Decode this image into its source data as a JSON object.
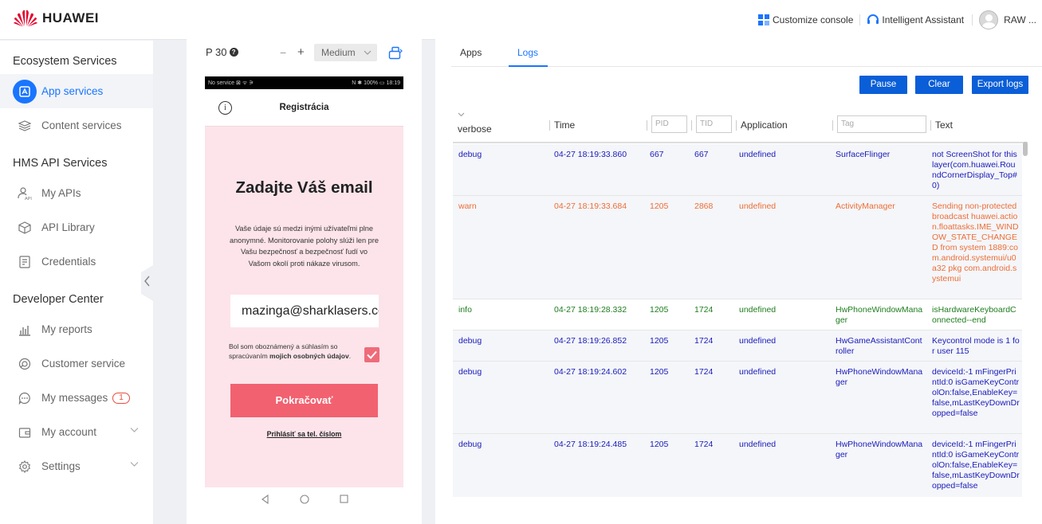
{
  "header": {
    "brand": "HUAWEI",
    "customize_console": "Customize console",
    "intelligent_assistant": "Intelligent Assistant",
    "user": "RAW ..."
  },
  "sidebar": {
    "sections": [
      {
        "title": "Ecosystem Services",
        "items": [
          {
            "label": "App services",
            "icon": "app-services-icon",
            "active": true
          },
          {
            "label": "Content services",
            "icon": "layers-icon"
          }
        ]
      },
      {
        "title": "HMS API Services",
        "items": [
          {
            "label": "My APIs",
            "icon": "api-user-icon"
          },
          {
            "label": "API Library",
            "icon": "cube-icon"
          },
          {
            "label": "Credentials",
            "icon": "credentials-icon"
          }
        ]
      },
      {
        "title": "Developer Center",
        "items": [
          {
            "label": "My reports",
            "icon": "bar-chart-icon"
          },
          {
            "label": "Customer service",
            "icon": "headset-icon"
          },
          {
            "label": "My messages",
            "icon": "chat-icon",
            "badge": "1"
          },
          {
            "label": "My account",
            "icon": "wallet-icon",
            "expandable": true
          },
          {
            "label": "Settings",
            "icon": "gear-icon",
            "expandable": true
          }
        ]
      }
    ]
  },
  "device": {
    "model": "P 30",
    "zoom_minus": "−",
    "zoom_plus": "+",
    "size": "Medium",
    "statusbar_left": "No service ⊠ ᯤ ⚞",
    "statusbar_right": "N ✱ 100% ▭ 18:19"
  },
  "app": {
    "header_title": "Registrácia",
    "info_glyph": "i",
    "heading": "Zadajte Váš email",
    "description": "Vaše údaje sú medzi inými užívateľmi plne anonymné. Monitorovanie polohy slúži len pre Vašu bezpečnosť a bezpečnosť ľudí vo Vašom okolí proti nákaze virusom.",
    "email_value": "mazinga@sharklasers.com",
    "consent_prefix": "Bol som oboznámený a súhlasím so spracúvaním ",
    "consent_bold": "mojich osobných údajov",
    "consent_suffix": ".",
    "checkbox_checked": true,
    "continue_button": "Pokračovať",
    "phone_login_link": "Prihlásiť sa tel. číslom"
  },
  "logs": {
    "tabs": [
      "Apps",
      "Logs"
    ],
    "active_tab": "Logs",
    "buttons": {
      "pause": "Pause",
      "clear": "Clear",
      "export": "Export logs"
    },
    "level_filter": "verbose",
    "columns": {
      "time": "Time",
      "pid_placeholder": "PID",
      "tid_placeholder": "TID",
      "application": "Application",
      "tag_placeholder": "Tag",
      "text": "Text"
    },
    "level_colors": {
      "debug": "#1a1ab8",
      "warn": "#ee6d37",
      "info": "#1e7d1e"
    },
    "rows": [
      {
        "level": "debug",
        "time": "04-27 18:19:33.860",
        "pid": "667",
        "tid": "667",
        "app": "undefined",
        "tag": "SurfaceFlinger",
        "text": "not ScreenShot for this layer(com.huawei.RoundCornerDisplay_Top#0)"
      },
      {
        "level": "warn",
        "time": "04-27 18:19:33.684",
        "pid": "1205",
        "tid": "2868",
        "app": "undefined",
        "tag": "ActivityManager",
        "text": "Sending non-protected broadcast huawei.action.floattasks.IME_WINDOW_STATE_CHANGED from system 1889:com.android.systemui/u0a32 pkg com.android.systemui"
      },
      {
        "level": "info",
        "time": "04-27 18:19:28.332",
        "pid": "1205",
        "tid": "1724",
        "app": "undefined",
        "tag": "HwPhoneWindowManager",
        "text": "isHardwareKeyboardConnected--end"
      },
      {
        "level": "debug",
        "time": "04-27 18:19:26.852",
        "pid": "1205",
        "tid": "1724",
        "app": "undefined",
        "tag": "HwGameAssistantController",
        "text": "Keycontrol mode is 1 for user 115"
      },
      {
        "level": "debug",
        "time": "04-27 18:19:24.602",
        "pid": "1205",
        "tid": "1724",
        "app": "undefined",
        "tag": "HwPhoneWindowManager",
        "text": "deviceId:-1 mFingerPrintId:0 isGameKeyControlOn:false,EnableKey=false,mLastKeyDownDropped=false"
      },
      {
        "level": "debug",
        "time": "04-27 18:19:24.485",
        "pid": "1205",
        "tid": "1724",
        "app": "undefined",
        "tag": "HwPhoneWindowManager",
        "text": "deviceId:-1 mFingerPrintId:0 isGameKeyControlOn:false,EnableKey=false,mLastKeyDownDropped=false"
      }
    ]
  }
}
